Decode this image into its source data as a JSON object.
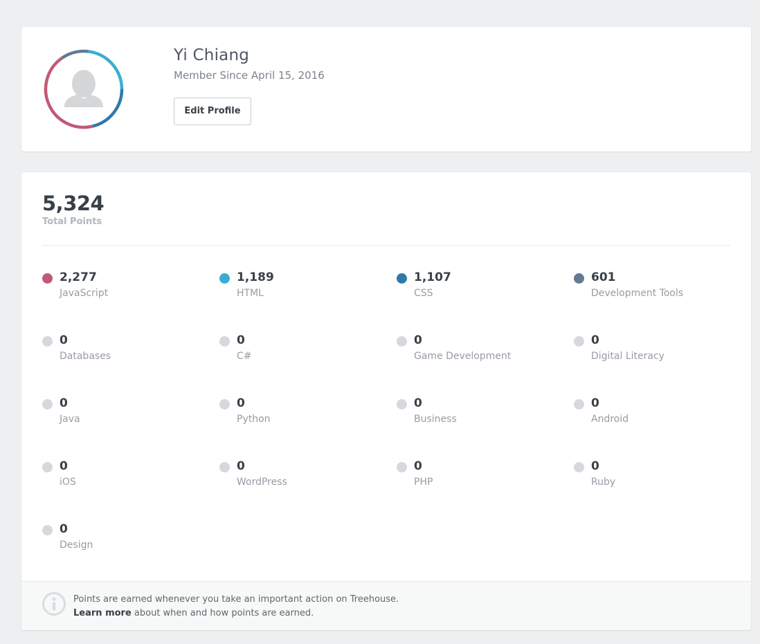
{
  "profile": {
    "name": "Yi Chiang",
    "member_since": "Member Since April 15, 2016",
    "edit_label": "Edit Profile",
    "avatar_icon": "user-silhouette-icon",
    "ring_segments": [
      {
        "name": "JavaScript",
        "points": 2277,
        "color": "#c25975"
      },
      {
        "name": "HTML",
        "points": 1189,
        "color": "#39add1"
      },
      {
        "name": "CSS",
        "points": 1107,
        "color": "#3079ab"
      },
      {
        "name": "Development Tools",
        "points": 601,
        "color": "#637a91"
      }
    ]
  },
  "points": {
    "total": "5,324",
    "total_label": "Total Points",
    "topics": [
      {
        "value": "2,277",
        "label": "JavaScript",
        "color": "#c25975"
      },
      {
        "value": "1,189",
        "label": "HTML",
        "color": "#39add1"
      },
      {
        "value": "1,107",
        "label": "CSS",
        "color": "#3079ab"
      },
      {
        "value": "601",
        "label": "Development Tools",
        "color": "#637a91"
      },
      {
        "value": "0",
        "label": "Databases",
        "color": "#d5d9dd"
      },
      {
        "value": "0",
        "label": "C#",
        "color": "#d5d9dd"
      },
      {
        "value": "0",
        "label": "Game Development",
        "color": "#d5d9dd"
      },
      {
        "value": "0",
        "label": "Digital Literacy",
        "color": "#d5d9dd"
      },
      {
        "value": "0",
        "label": "Java",
        "color": "#d5d9dd"
      },
      {
        "value": "0",
        "label": "Python",
        "color": "#d5d9dd"
      },
      {
        "value": "0",
        "label": "Business",
        "color": "#d5d9dd"
      },
      {
        "value": "0",
        "label": "Android",
        "color": "#d5d9dd"
      },
      {
        "value": "0",
        "label": "iOS",
        "color": "#d5d9dd"
      },
      {
        "value": "0",
        "label": "WordPress",
        "color": "#d5d9dd"
      },
      {
        "value": "0",
        "label": "PHP",
        "color": "#d5d9dd"
      },
      {
        "value": "0",
        "label": "Ruby",
        "color": "#d5d9dd"
      },
      {
        "value": "0",
        "label": "Design",
        "color": "#d5d9dd"
      }
    ]
  },
  "footer": {
    "icon": "info-icon",
    "line1": "Points are earned whenever you take an important action on Treehouse.",
    "learn_more": "Learn more",
    "line2_rest": " about when and how points are earned."
  }
}
